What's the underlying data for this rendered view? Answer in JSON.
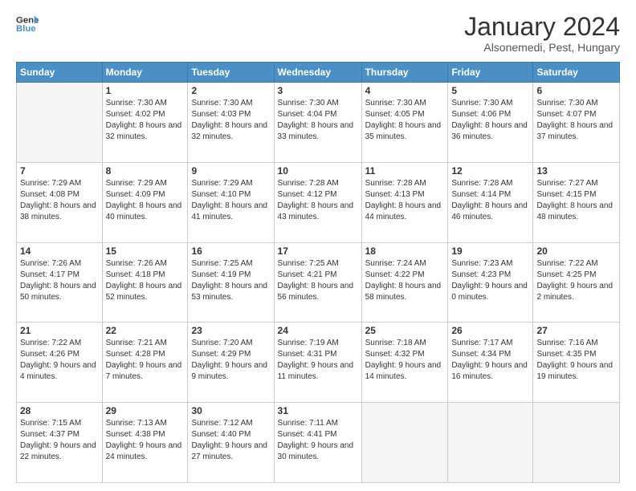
{
  "header": {
    "logo_line1": "General",
    "logo_line2": "Blue",
    "main_title": "January 2024",
    "subtitle": "Alsonemedi, Pest, Hungary"
  },
  "weekdays": [
    "Sunday",
    "Monday",
    "Tuesday",
    "Wednesday",
    "Thursday",
    "Friday",
    "Saturday"
  ],
  "weeks": [
    [
      {
        "day": "",
        "sunrise": "",
        "sunset": "",
        "daylight": ""
      },
      {
        "day": "1",
        "sunrise": "7:30 AM",
        "sunset": "4:02 PM",
        "daylight": "8 hours and 32 minutes."
      },
      {
        "day": "2",
        "sunrise": "7:30 AM",
        "sunset": "4:03 PM",
        "daylight": "8 hours and 32 minutes."
      },
      {
        "day": "3",
        "sunrise": "7:30 AM",
        "sunset": "4:04 PM",
        "daylight": "8 hours and 33 minutes."
      },
      {
        "day": "4",
        "sunrise": "7:30 AM",
        "sunset": "4:05 PM",
        "daylight": "8 hours and 35 minutes."
      },
      {
        "day": "5",
        "sunrise": "7:30 AM",
        "sunset": "4:06 PM",
        "daylight": "8 hours and 36 minutes."
      },
      {
        "day": "6",
        "sunrise": "7:30 AM",
        "sunset": "4:07 PM",
        "daylight": "8 hours and 37 minutes."
      }
    ],
    [
      {
        "day": "7",
        "sunrise": "7:29 AM",
        "sunset": "4:08 PM",
        "daylight": "8 hours and 38 minutes."
      },
      {
        "day": "8",
        "sunrise": "7:29 AM",
        "sunset": "4:09 PM",
        "daylight": "8 hours and 40 minutes."
      },
      {
        "day": "9",
        "sunrise": "7:29 AM",
        "sunset": "4:10 PM",
        "daylight": "8 hours and 41 minutes."
      },
      {
        "day": "10",
        "sunrise": "7:28 AM",
        "sunset": "4:12 PM",
        "daylight": "8 hours and 43 minutes."
      },
      {
        "day": "11",
        "sunrise": "7:28 AM",
        "sunset": "4:13 PM",
        "daylight": "8 hours and 44 minutes."
      },
      {
        "day": "12",
        "sunrise": "7:28 AM",
        "sunset": "4:14 PM",
        "daylight": "8 hours and 46 minutes."
      },
      {
        "day": "13",
        "sunrise": "7:27 AM",
        "sunset": "4:15 PM",
        "daylight": "8 hours and 48 minutes."
      }
    ],
    [
      {
        "day": "14",
        "sunrise": "7:26 AM",
        "sunset": "4:17 PM",
        "daylight": "8 hours and 50 minutes."
      },
      {
        "day": "15",
        "sunrise": "7:26 AM",
        "sunset": "4:18 PM",
        "daylight": "8 hours and 52 minutes."
      },
      {
        "day": "16",
        "sunrise": "7:25 AM",
        "sunset": "4:19 PM",
        "daylight": "8 hours and 53 minutes."
      },
      {
        "day": "17",
        "sunrise": "7:25 AM",
        "sunset": "4:21 PM",
        "daylight": "8 hours and 56 minutes."
      },
      {
        "day": "18",
        "sunrise": "7:24 AM",
        "sunset": "4:22 PM",
        "daylight": "8 hours and 58 minutes."
      },
      {
        "day": "19",
        "sunrise": "7:23 AM",
        "sunset": "4:23 PM",
        "daylight": "9 hours and 0 minutes."
      },
      {
        "day": "20",
        "sunrise": "7:22 AM",
        "sunset": "4:25 PM",
        "daylight": "9 hours and 2 minutes."
      }
    ],
    [
      {
        "day": "21",
        "sunrise": "7:22 AM",
        "sunset": "4:26 PM",
        "daylight": "9 hours and 4 minutes."
      },
      {
        "day": "22",
        "sunrise": "7:21 AM",
        "sunset": "4:28 PM",
        "daylight": "9 hours and 7 minutes."
      },
      {
        "day": "23",
        "sunrise": "7:20 AM",
        "sunset": "4:29 PM",
        "daylight": "9 hours and 9 minutes."
      },
      {
        "day": "24",
        "sunrise": "7:19 AM",
        "sunset": "4:31 PM",
        "daylight": "9 hours and 11 minutes."
      },
      {
        "day": "25",
        "sunrise": "7:18 AM",
        "sunset": "4:32 PM",
        "daylight": "9 hours and 14 minutes."
      },
      {
        "day": "26",
        "sunrise": "7:17 AM",
        "sunset": "4:34 PM",
        "daylight": "9 hours and 16 minutes."
      },
      {
        "day": "27",
        "sunrise": "7:16 AM",
        "sunset": "4:35 PM",
        "daylight": "9 hours and 19 minutes."
      }
    ],
    [
      {
        "day": "28",
        "sunrise": "7:15 AM",
        "sunset": "4:37 PM",
        "daylight": "9 hours and 22 minutes."
      },
      {
        "day": "29",
        "sunrise": "7:13 AM",
        "sunset": "4:38 PM",
        "daylight": "9 hours and 24 minutes."
      },
      {
        "day": "30",
        "sunrise": "7:12 AM",
        "sunset": "4:40 PM",
        "daylight": "9 hours and 27 minutes."
      },
      {
        "day": "31",
        "sunrise": "7:11 AM",
        "sunset": "4:41 PM",
        "daylight": "9 hours and 30 minutes."
      },
      {
        "day": "",
        "sunrise": "",
        "sunset": "",
        "daylight": ""
      },
      {
        "day": "",
        "sunrise": "",
        "sunset": "",
        "daylight": ""
      },
      {
        "day": "",
        "sunrise": "",
        "sunset": "",
        "daylight": ""
      }
    ]
  ]
}
